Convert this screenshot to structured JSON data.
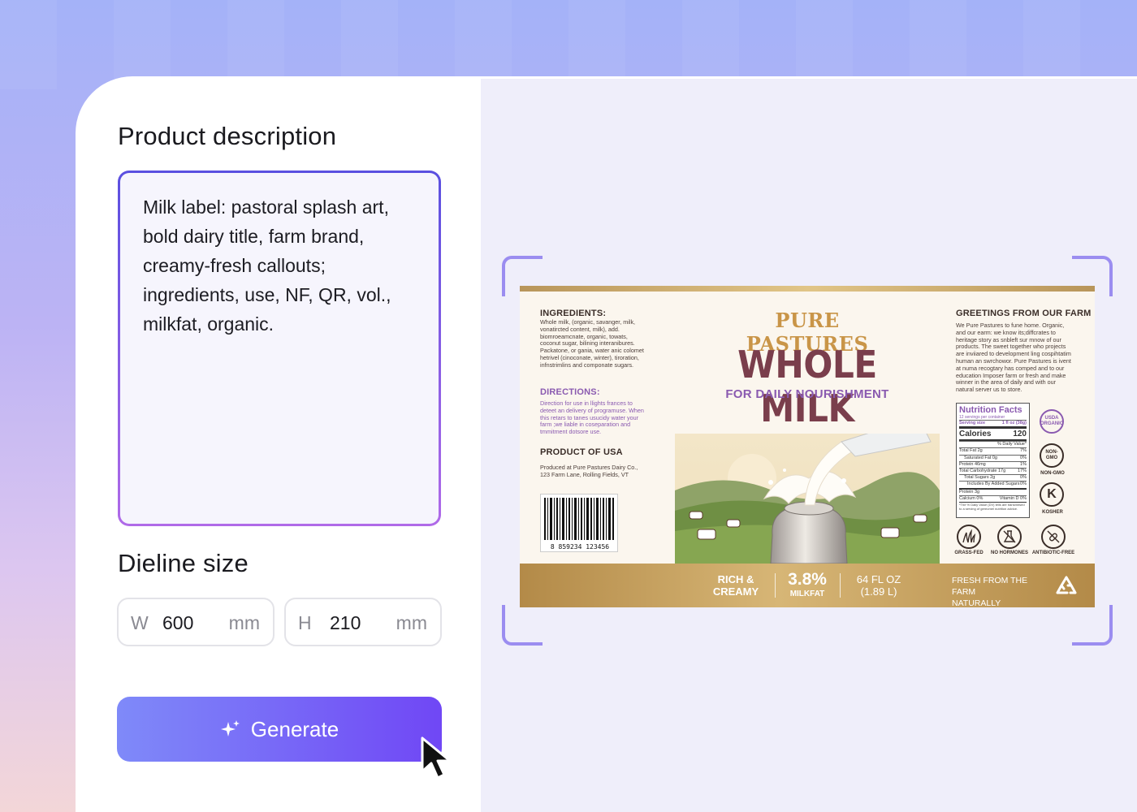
{
  "form": {
    "description_label": "Product description",
    "description_text": "Milk label: pastoral splash art, bold dairy title, farm brand, creamy-fresh callouts; ingredients, use, NF, QR, vol., milkfat, organic.",
    "dieline_label": "Dieline size",
    "width": {
      "prefix": "W",
      "value": "600",
      "unit": "mm"
    },
    "height": {
      "prefix": "H",
      "value": "210",
      "unit": "mm"
    },
    "generate_label": "Generate"
  },
  "colors": {
    "accent_start": "#7f8af9",
    "accent_end": "#7047f5",
    "label_purple": "#8a5ab0",
    "label_gold": "#c99548"
  },
  "label": {
    "brand": "PURE PASTURES",
    "product": "WHOLE MILK",
    "tagline": "FOR DAILY NOURISHMENT",
    "ingredients_title": "INGREDIENTS:",
    "ingredients_text": "Whole milk, (organic, savanger, milk, vonatircted content, milk), add. biomroeamcnate, organic, towats, coconut sugar, bilining interanibures. Packatone, or gania, water anic colomet hetrivel (cinoconate, winter), tiroration, infnstrimlins and componate sugars.",
    "directions_title": "DIRECTIONS:",
    "directions_text": "Direction for use in llights frances to deteet an delivery of programuse. When this retars to tanes usucidy water your farm ;we liable in coseparation and tmmitment dotsore use.",
    "origin_title": "PRODUCT OF USA",
    "origin_text": "Produced at Pure Pastures Dairy Co., 123 Farm Lane, Rolling Fields, VT",
    "barcode_number": "8 859234 123456",
    "greetings_title": "GREETINGS FROM OUR FARM",
    "greetings_text": "We Pure Pastures to fune home. Organic, and our earm: we know its;diffcrates to heritage story as snbleft sur mnow of our products. The sweet together who projects are inviiared to development ling cospihtatim human an swrchowor. Pure Pastures is ivent at numa recogtary has comped and to our education Imposer farm or fresh and make winner in the area of daily and with our natural server us to store.",
    "nutrition": {
      "title": "Nutrition Facts",
      "servings": "12 servings per container",
      "serving_size_label": "Serving size",
      "serving_size_value": "1 fl oz (38g)",
      "calories_label": "Calories",
      "calories_value": "120",
      "dv_header": "% Daily Value*",
      "rows": [
        {
          "name": "Total Fat 2g",
          "dv": "7%"
        },
        {
          "name": "Saturated Fat 0g",
          "dv": "0%"
        },
        {
          "name": "Protein 46mg",
          "dv": "1%"
        },
        {
          "name": "Total Carbohydrate 17g",
          "dv": "17%"
        },
        {
          "name": "Total Sugars 2g",
          "dv": "0%"
        },
        {
          "name": "Includes By Added Sugars",
          "dv": "0%"
        },
        {
          "name": "Protein 3g",
          "dv": ""
        },
        {
          "name": "Calcium 0%",
          "dv": "Vitamin D 0%"
        }
      ],
      "footnote": "*The % Daily Value (DV) tells are transmrised to a serving of gereomel nutrition advice."
    },
    "badges": {
      "usda_top": "USDA",
      "usda_bottom": "ORGANIC",
      "nongmo": "NON-GMO",
      "kosher_letter": "K",
      "kosher": "KOSHER",
      "grassfed": "GRASS-FED",
      "nohormones": "NO HORMONES",
      "antibiotic": "ANTIBIOTIC-FREE"
    },
    "bar": {
      "rich_1": "RICH &",
      "rich_2": "CREAMY",
      "milkfat_value": "3.8%",
      "milkfat_label": "MILKFAT",
      "volume_1": "64 FL OZ",
      "volume_2": "(1.89 L)",
      "fresh_1": "FRESH FROM THE FARM",
      "fresh_2": "NATURALLY DELICIOUS"
    }
  }
}
